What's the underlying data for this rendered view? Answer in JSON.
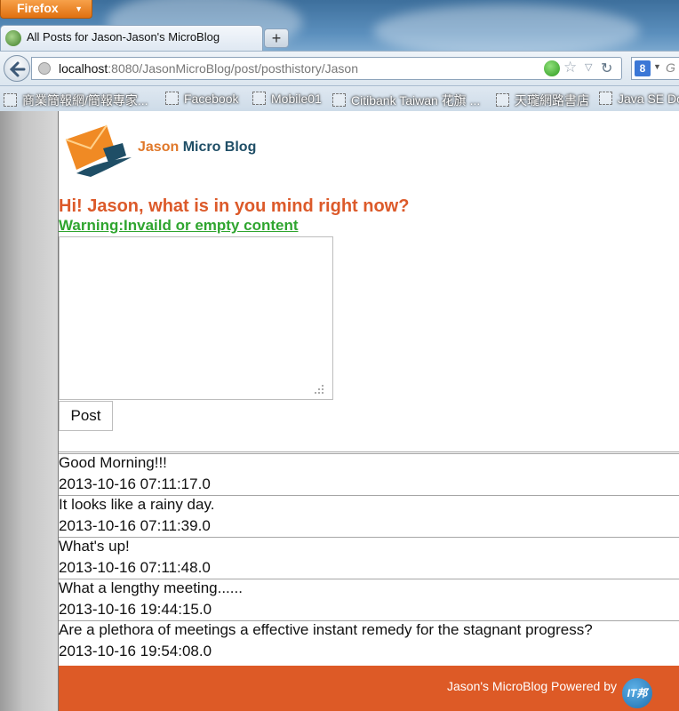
{
  "browser": {
    "menu_label": "Firefox",
    "tab_title": "All Posts for Jason-Jason's MicroBlog",
    "url_host": "localhost",
    "url_path": ":8080/JasonMicroBlog/post/posthistory/Jason",
    "search_engine_letter": "8",
    "search_hint": "G",
    "bookmarks": [
      "商業簡報網/簡報專家...",
      "Facebook",
      "Mobile01",
      "Citibank Taiwan 花旗 ...",
      "天瓏網路書店",
      "Java SE Do"
    ]
  },
  "site": {
    "brand_part1": "Jason ",
    "brand_part2": "Micro Blog",
    "prompt": "Hi! Jason, what is in you mind right now?",
    "warning": "Warning:Invaild or empty content",
    "post_button": "Post",
    "post_content": ""
  },
  "posts": [
    {
      "text": "Good Morning!!!",
      "time": "2013-10-16 07:11:17.0"
    },
    {
      "text": "It looks like a rainy day.",
      "time": "2013-10-16 07:11:39.0"
    },
    {
      "text": "What's up!",
      "time": "2013-10-16 07:11:48.0"
    },
    {
      "text": "What a lengthy meeting......",
      "time": "2013-10-16 19:44:15.0"
    },
    {
      "text": "Are a plethora of meetings a effective instant remedy for the stagnant progress?",
      "time": "2013-10-16 19:54:08.0"
    }
  ],
  "footer": {
    "text": "Jason's MicroBlog Powered by",
    "badge": "IT邦"
  },
  "colors": {
    "accent_orange": "#dd5a26",
    "warning_green": "#2fa52f",
    "brand_navy": "#1f4e66"
  }
}
